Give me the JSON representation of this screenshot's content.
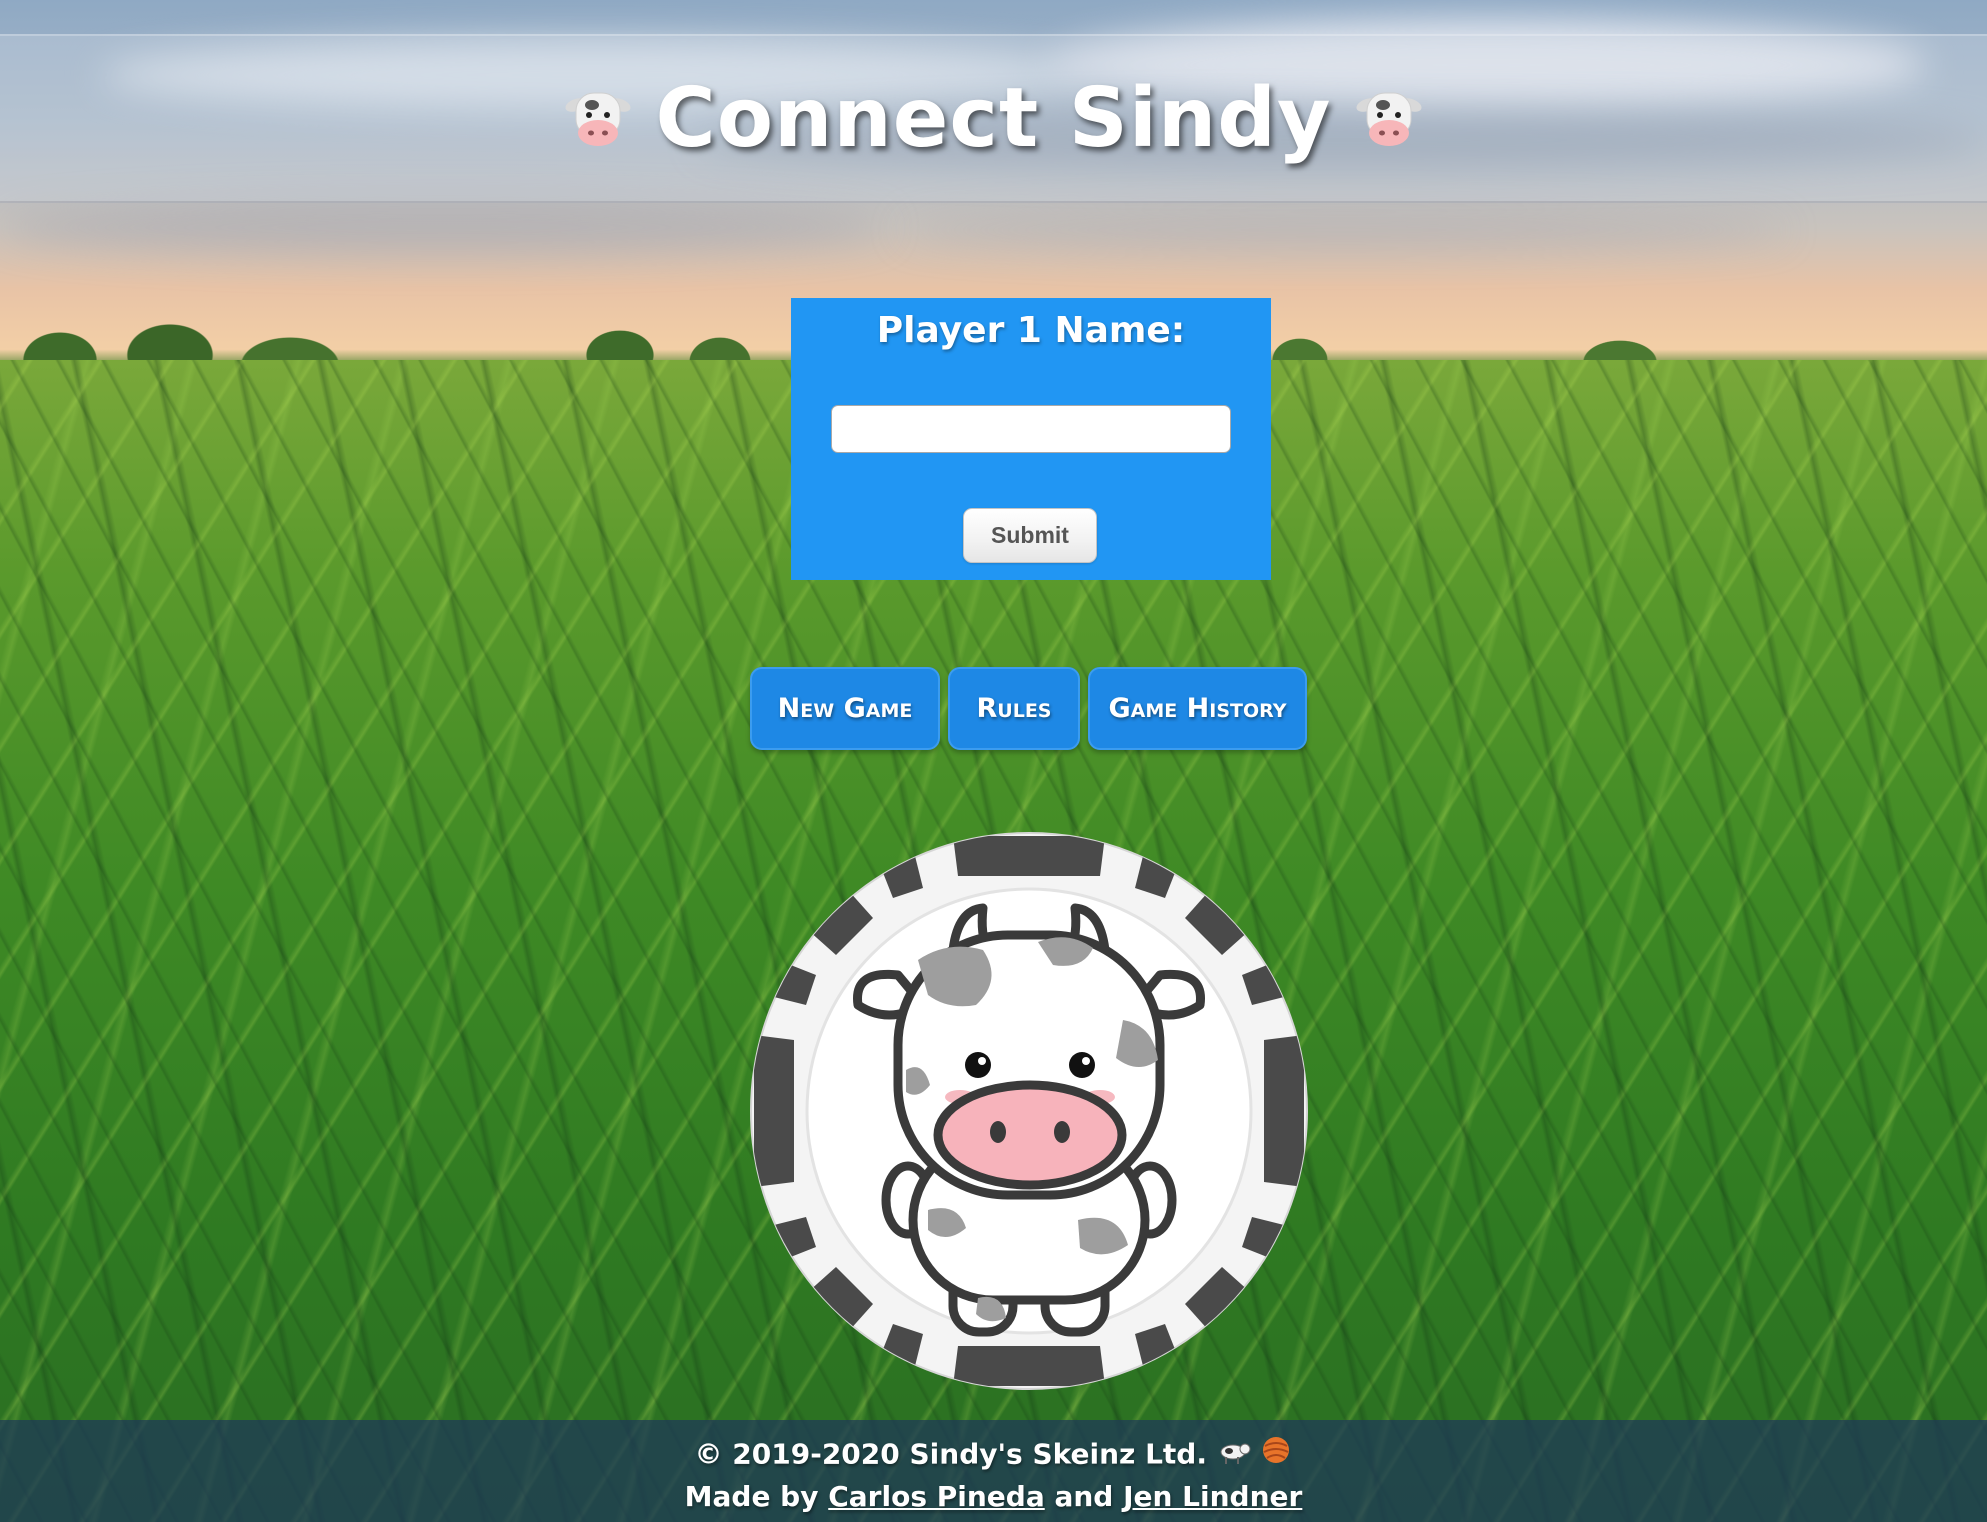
{
  "header": {
    "title": "Connect Sindy",
    "left_icon": "cow-face-icon",
    "right_icon": "cow-face-icon"
  },
  "name_form": {
    "label": "Player 1 Name:",
    "input_value": "",
    "submit_label": "Submit"
  },
  "nav": {
    "new_game_label": "New Game",
    "rules_label": "Rules",
    "history_label": "Game History"
  },
  "game_piece": {
    "icon": "cow-chip-icon"
  },
  "footer": {
    "copyright": "© 2019-2020 Sindy's Skeinz Ltd.",
    "copyright_icons": [
      "cow-icon",
      "yarn-ball-icon"
    ],
    "made_by_prefix": "Made by",
    "author1": "Carlos Pineda",
    "conjunction": "and",
    "author2": "Jen Lindner"
  },
  "colors": {
    "form_background": "#2196f3",
    "nav_button": "#1e88e5",
    "footer_background": "#1e375a"
  }
}
